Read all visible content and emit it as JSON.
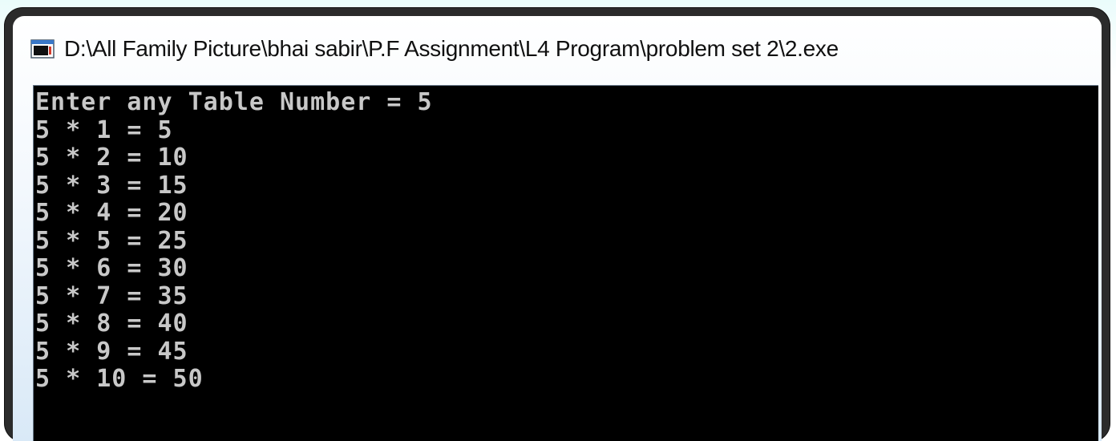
{
  "window": {
    "title": "D:\\All Family Picture\\bhai sabir\\P.F Assignment\\L4 Program\\problem set 2\\2.exe",
    "icon": "console-app-icon"
  },
  "console": {
    "lines": [
      "Enter any Table Number = 5",
      "5 * 1 = 5",
      "5 * 2 = 10",
      "5 * 3 = 15",
      "5 * 4 = 20",
      "5 * 5 = 25",
      "5 * 6 = 30",
      "5 * 7 = 35",
      "5 * 8 = 40",
      "5 * 9 = 45",
      "5 * 10 = 50"
    ]
  },
  "colors": {
    "console_background": "#000000",
    "console_text": "#c8c8c8",
    "titlebar": "#e8f1fa"
  }
}
